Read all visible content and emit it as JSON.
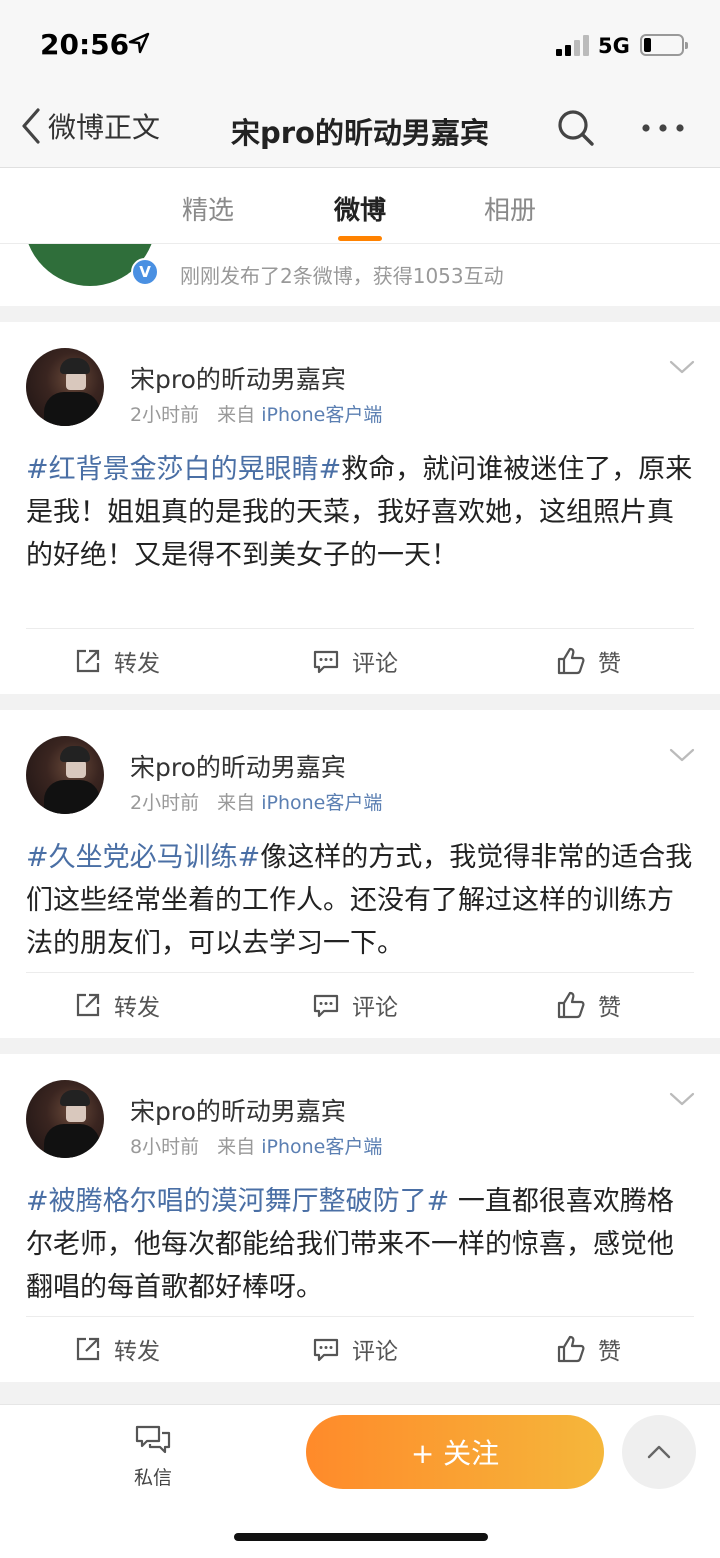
{
  "status": {
    "time": "20:56",
    "network": "5G",
    "battery_level": 0.2
  },
  "nav": {
    "back_label": "微博正文",
    "title": "宋pro的昕动男嘉宾"
  },
  "tabs": [
    {
      "label": "精选",
      "active": false
    },
    {
      "label": "微博",
      "active": true
    },
    {
      "label": "相册",
      "active": false
    }
  ],
  "profile": {
    "summary": "刚刚发布了2条微博，获得1053互动",
    "verify_mark": "V",
    "avatar_color": "#2f6e3a"
  },
  "posts": [
    {
      "username": "宋pro的昕动男嘉宾",
      "time": "2小时前",
      "from": "来自",
      "source": "iPhone客户端",
      "hashtag": "#红背景金莎白的晃眼睛#",
      "text": "救命，就问谁被迷住了，原来是我！姐姐真的是我的天菜，我好喜欢她，这组照片真的好绝！又是得不到美女子的一天！"
    },
    {
      "username": "宋pro的昕动男嘉宾",
      "time": "2小时前",
      "from": "来自",
      "source": "iPhone客户端",
      "hashtag": "#久坐党必马训练#",
      "text": "像这样的方式，我觉得非常的适合我们这些经常坐着的工作人。还没有了解过这样的训练方法的朋友们，可以去学习一下。"
    },
    {
      "username": "宋pro的昕动男嘉宾",
      "time": "8小时前",
      "from": "来自",
      "source": "iPhone客户端",
      "hashtag": "#被腾格尔唱的漠河舞厅整破防了#",
      "text": " 一直都很喜欢腾格尔老师，他每次都能给我们带来不一样的惊喜，感觉他翻唱的每首歌都好棒呀。"
    }
  ],
  "actions": {
    "repost": "转发",
    "comment": "评论",
    "like": "赞"
  },
  "bottom": {
    "dm_label": "私信",
    "follow_label": "+ 关注"
  },
  "colors": {
    "accent": "#ff8200",
    "link": "#4a6fa5",
    "follow_start": "#ff8a2a",
    "follow_end": "#f5b73b"
  }
}
